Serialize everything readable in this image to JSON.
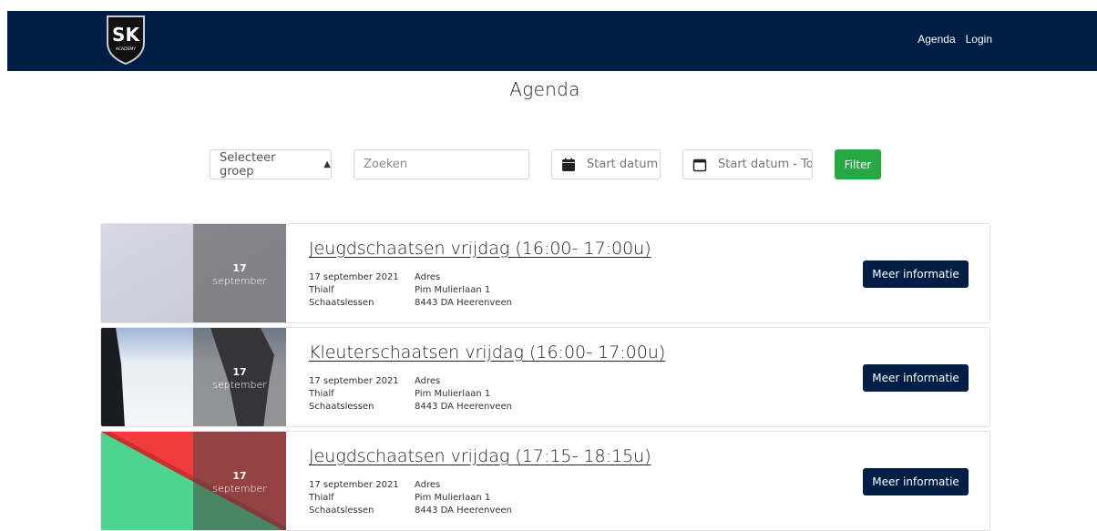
{
  "nav": {
    "logo_text": "SK",
    "logo_subtext": "ACADEMY",
    "links": [
      "Agenda",
      "Login"
    ]
  },
  "page": {
    "title": "Agenda"
  },
  "filters": {
    "group_select": "Selecteer groep",
    "search_placeholder": "Zoeken",
    "start_date": "Start datum",
    "end_date": "Start datum - To",
    "filter_button": "Filter"
  },
  "events": [
    {
      "title": "Jeugdschaatsen vrijdag (16:00- 17:00u)",
      "day": "17",
      "month": "september",
      "date": "17 september 2021",
      "location": "Thialf",
      "category": "Schaatslessen",
      "address_label": "Adres",
      "street": "Pim Mulierlaan 1",
      "city": "8443 DA Heerenveen",
      "button": "Meer informatie"
    },
    {
      "title": "Kleuterschaatsen vrijdag (16:00- 17:00u)",
      "day": "17",
      "month": "september",
      "date": "17 september 2021",
      "location": "Thialf",
      "category": "Schaatslessen",
      "address_label": "Adres",
      "street": "Pim Mulierlaan 1",
      "city": "8443 DA Heerenveen",
      "button": "Meer informatie"
    },
    {
      "title": "Jeugdschaatsen vrijdag (17:15- 18:15u)",
      "day": "17",
      "month": "september",
      "date": "17 september 2021",
      "location": "Thialf",
      "category": "Schaatslessen",
      "address_label": "Adres",
      "street": "Pim Mulierlaan 1",
      "city": "8443 DA Heerenveen",
      "button": "Meer informatie"
    }
  ],
  "colors": {
    "navbar": "#001d45",
    "filter_button": "#28a745",
    "info_button": "#001d45"
  }
}
